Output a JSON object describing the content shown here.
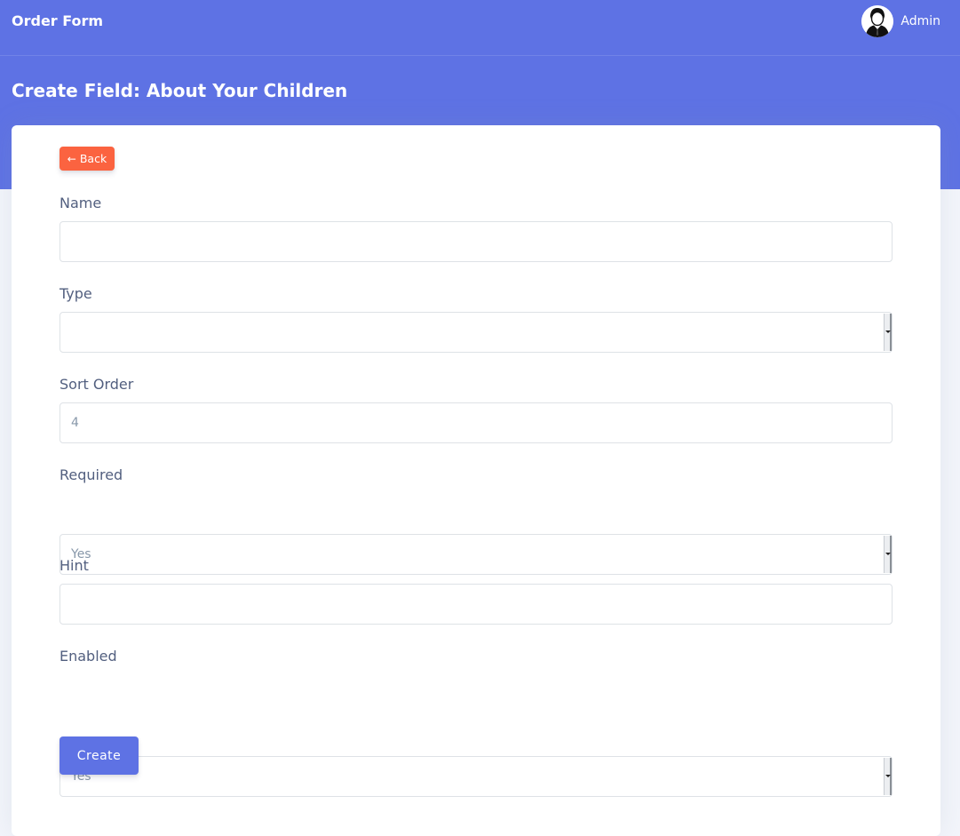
{
  "app": {
    "title": "Order Form"
  },
  "user": {
    "name": "Admin",
    "avatar_icon": "user-avatar-icon"
  },
  "page": {
    "title": "Create Field: About Your Children"
  },
  "back_button": {
    "label": "Back",
    "icon": "arrow-left-icon"
  },
  "form": {
    "name": {
      "label": "Name",
      "value": ""
    },
    "type": {
      "label": "Type",
      "value": ""
    },
    "sort_order": {
      "label": "Sort Order",
      "value": "4"
    },
    "required": {
      "label": "Required",
      "value": "Yes"
    },
    "hint": {
      "label": "Hint",
      "value": ""
    },
    "enabled": {
      "label": "Enabled",
      "value": "Yes"
    },
    "submit_label": "Create"
  },
  "colors": {
    "primary": "#5e72e4",
    "accent": "#fb6340",
    "text": "#525f7f",
    "muted": "#8898aa",
    "background": "#f3f5fb"
  }
}
